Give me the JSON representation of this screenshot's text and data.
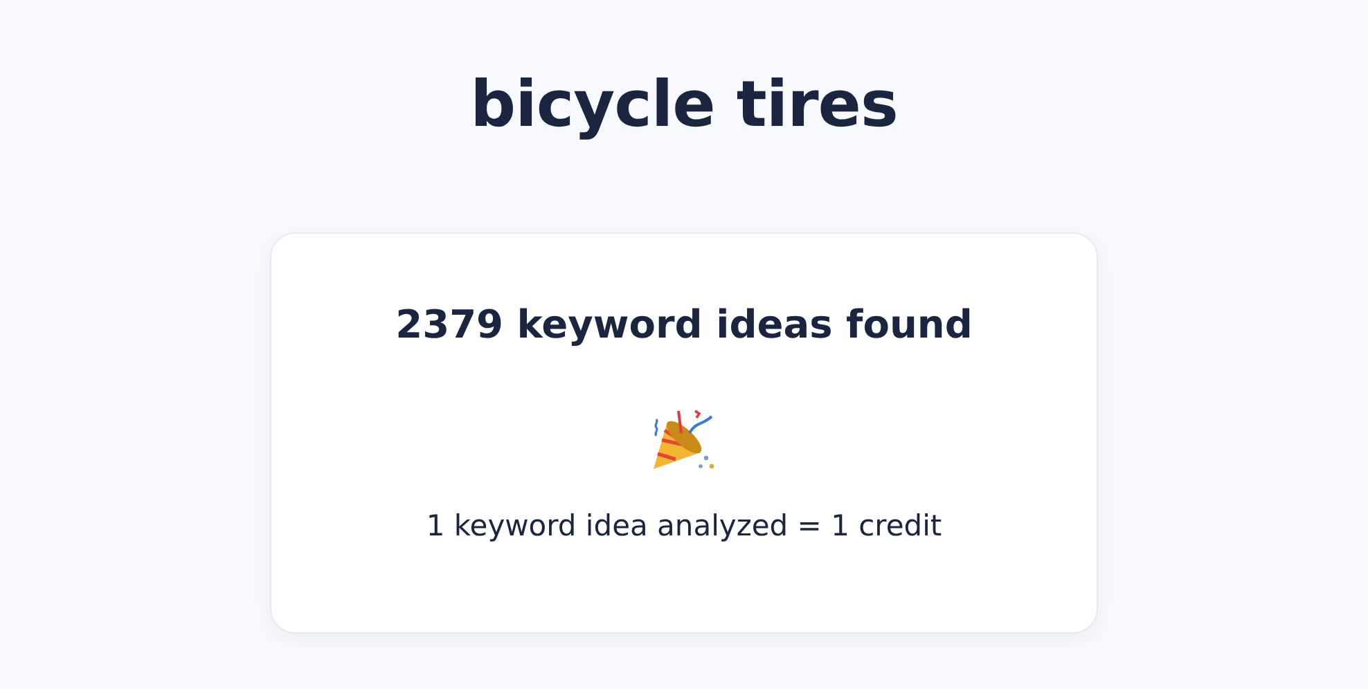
{
  "title": "bicycle tires",
  "card": {
    "heading": "2379 keyword ideas found",
    "note": "1 keyword idea analyzed = 1 credit"
  }
}
